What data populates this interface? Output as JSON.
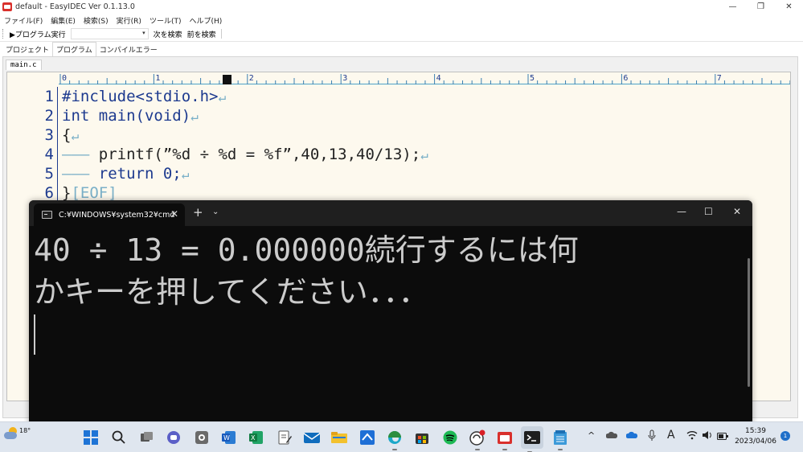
{
  "window": {
    "title": "default - EasyIDEC Ver 0.1.13.0",
    "controls": {
      "minimize": "—",
      "maximize": "❐",
      "close": "✕"
    }
  },
  "menu": [
    "ファイル(F)",
    "編集(E)",
    "検索(S)",
    "実行(R)",
    "ツール(T)",
    "ヘルプ(H)"
  ],
  "toolbar": {
    "run_label": "▶プログラム実行",
    "search_value": "",
    "find_next": "次を検索",
    "find_prev": "前を検索"
  },
  "tabs": [
    "プロジェクト",
    "プログラム",
    "コンパイルエラー"
  ],
  "active_tab": "プログラム",
  "editor": {
    "file_tab": "main.c",
    "ruler_labels": [
      "0",
      "1",
      "2",
      "3",
      "4",
      "5",
      "6",
      "7"
    ],
    "lines": [
      {
        "n": "1",
        "text": "#include<stdio.h>"
      },
      {
        "n": "2",
        "text": "int main(void)"
      },
      {
        "n": "3",
        "text": "{"
      },
      {
        "n": "4",
        "text": "printf(”%d ÷ %d = %f”,40,13,40/13);"
      },
      {
        "n": "5",
        "text": "return 0;"
      },
      {
        "n": "6",
        "text": "}"
      }
    ],
    "eof_marker": "[EOF]",
    "eol_marker": "↵",
    "colors": {
      "keyword": "#1d3a8f",
      "marker": "#7ab0c8",
      "background": "#fdf9ee"
    }
  },
  "cmd": {
    "tab_title": "C:¥WINDOWS¥system32¥cmd",
    "output_line1": "40 ÷ 13 = 0.000000続行するには何",
    "output_line2": "かキーを押してください．．．",
    "controls": {
      "add": "+",
      "dropdown": "⌄",
      "minimize": "—",
      "maximize": "☐",
      "close": "✕"
    }
  },
  "taskbar": {
    "temperature": "18°",
    "apps": [
      "windows-start",
      "search",
      "task-view",
      "teams-chat",
      "settings",
      "word",
      "excel",
      "notepad-edit",
      "mail",
      "file-explorer",
      "mail-app",
      "edge",
      "store",
      "spotify",
      "app-sync",
      "easyidec",
      "terminal",
      "notepad"
    ],
    "tray": {
      "chevron": "^",
      "ime": "A"
    },
    "time": "15:39",
    "date": "2023/04/06",
    "notifications": "1"
  }
}
